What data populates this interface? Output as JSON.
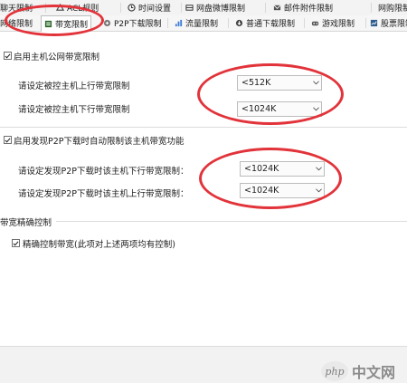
{
  "tabs_row1": [
    {
      "label": "聊天限制",
      "icon": "chat-icon"
    },
    {
      "label": "ACL规则",
      "icon": "acl-icon"
    },
    {
      "label": "时间设置",
      "icon": "clock-icon"
    },
    {
      "label": "网盘微博限制",
      "icon": "cloud-icon"
    },
    {
      "label": "邮件附件限制",
      "icon": "mail-icon"
    },
    {
      "label": "网购限制",
      "icon": "cart-icon"
    }
  ],
  "tabs_row2": [
    {
      "label": "网络限制",
      "icon": ""
    },
    {
      "label": "带宽限制",
      "icon": "bandwidth-icon",
      "active": true
    },
    {
      "label": "P2P下载限制",
      "icon": "p2p-icon"
    },
    {
      "label": "流量限制",
      "icon": "traffic-icon"
    },
    {
      "label": "普通下载限制",
      "icon": "download-icon"
    },
    {
      "label": "游戏限制",
      "icon": "game-icon"
    },
    {
      "label": "股票限制",
      "icon": "stock-icon"
    }
  ],
  "section1": {
    "checkbox_label": "启用主机公网带宽限制",
    "checked": true,
    "upload_label": "请设定被控主机上行带宽限制",
    "upload_value": "<512K",
    "download_label": "请设定被控主机下行带宽限制",
    "download_value": "<1024K"
  },
  "section2": {
    "checkbox_label": "启用发现P2P下载时自动限制该主机带宽功能",
    "checked": true,
    "down_label": "请设定发现P2P下载时该主机下行带宽限制：",
    "down_value": "<1024K",
    "up_label": "请设定发现P2P下载时该主机上行带宽限制：",
    "up_value": "<1024K"
  },
  "section3": {
    "heading": "带宽精确控制",
    "checkbox_label": "精确控制带宽(此项对上述两项均有控制)",
    "checked": true
  },
  "watermark": {
    "logo": "php",
    "text": "中文网"
  },
  "colors": {
    "annotation_red": "#e2333a"
  }
}
